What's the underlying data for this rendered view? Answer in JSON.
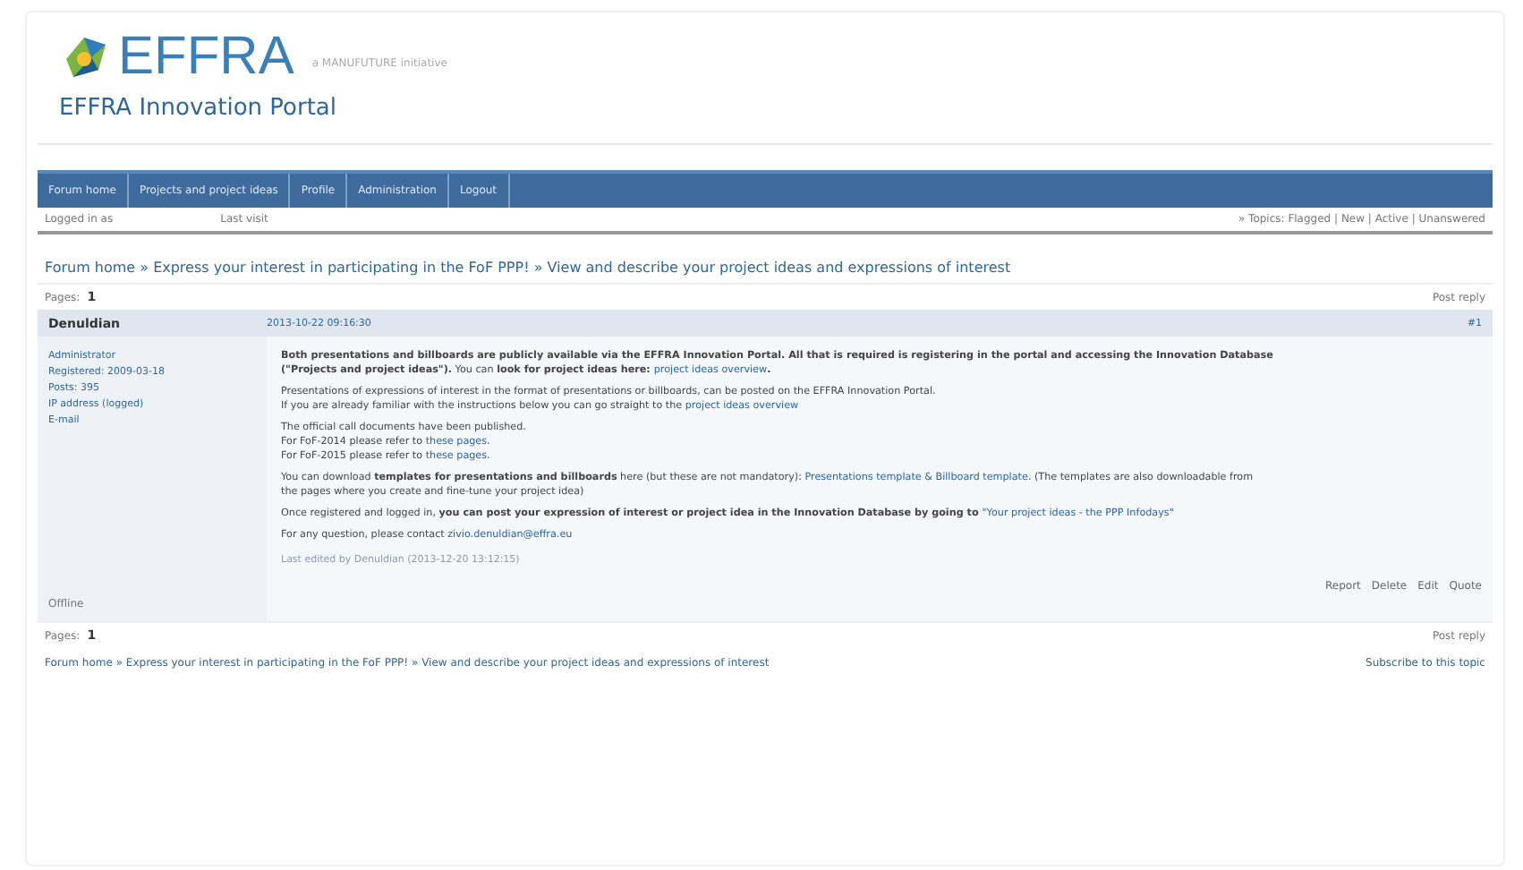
{
  "header": {
    "logo_text": "EFFRA",
    "tagline": "a MANUFUTURE initiative",
    "title": "EFFRA Innovation Portal"
  },
  "nav": [
    {
      "label": "Forum home"
    },
    {
      "label": "Projects and project ideas"
    },
    {
      "label": "Profile"
    },
    {
      "label": "Administration"
    },
    {
      "label": "Logout"
    }
  ],
  "status": {
    "logged_in": "Logged in as",
    "last_visit": "Last visit",
    "topics": "» Topics: Flagged | New | Active | Unanswered"
  },
  "breadcrumb": "Forum home » Express your interest in participating in the FoF PPP! » View and describe your project ideas and expressions of interest",
  "pages_top": {
    "label": "Pages:",
    "page": "1",
    "action": "Post reply"
  },
  "post": {
    "author": "Denuldian",
    "date": "2013-10-22 09:16:30",
    "number": "#1",
    "author_info": [
      "Administrator",
      "Registered: 2009-03-18",
      "Posts: 395",
      "IP address (logged)"
    ],
    "email": "E-mail",
    "paragraphs": [
      [
        [
          {
            "kind": "bold",
            "text": "Both presentations and billboards are publicly available via the EFFRA Innovation Portal.  All that is required is registering in the portal and accessing the Innovation Database"
          }
        ],
        [
          {
            "kind": "bold",
            "text": "(\"Projects and project ideas\")."
          },
          {
            "kind": "text",
            "text": "  You can "
          },
          {
            "kind": "bold",
            "text": "look for project ideas here: "
          },
          {
            "kind": "link",
            "text": "project ideas overview"
          },
          {
            "kind": "bold",
            "text": "."
          }
        ]
      ],
      [
        [
          {
            "kind": "text",
            "text": "Presentations of expressions of interest in the format of presentations or billboards, can be posted on the EFFRA Innovation Portal."
          }
        ],
        [
          {
            "kind": "text",
            "text": "If you are already familiar with the instructions below you can go straight to the "
          },
          {
            "kind": "link",
            "text": "project ideas overview"
          }
        ]
      ],
      [
        [
          {
            "kind": "text",
            "text": "The official call documents have been published."
          }
        ],
        [
          {
            "kind": "text",
            "text": "For FoF-2014 please refer to "
          },
          {
            "kind": "link",
            "text": "these pages"
          },
          {
            "kind": "text",
            "text": "."
          }
        ],
        [
          {
            "kind": "text",
            "text": "For FoF-2015 please refer to "
          },
          {
            "kind": "link",
            "text": "these pages"
          },
          {
            "kind": "text",
            "text": "."
          }
        ]
      ],
      [
        [
          {
            "kind": "text",
            "text": "You can download "
          },
          {
            "kind": "bold",
            "text": "templates for presentations and billboards"
          },
          {
            "kind": "text",
            "text": " here (but these are not mandatory): "
          },
          {
            "kind": "link",
            "text": "Presentations template & Billboard template"
          },
          {
            "kind": "text",
            "text": ".  (The templates are also downloadable from"
          }
        ],
        [
          {
            "kind": "text",
            "text": "the pages where you create and fine-tune your project idea)"
          }
        ]
      ],
      [
        [
          {
            "kind": "text",
            "text": "Once registered and logged in, "
          },
          {
            "kind": "bold",
            "text": "you can post your expression of interest or project idea in the Innovation Database by going to "
          },
          {
            "kind": "link",
            "text": "\"Your project ideas - the PPP Infodays\""
          }
        ]
      ],
      [
        [
          {
            "kind": "text",
            "text": "For any question, please contact "
          },
          {
            "kind": "link",
            "text": "zivio.denuldian@effra.eu"
          }
        ]
      ]
    ],
    "edited": "Last edited by Denuldian (2013-12-20 13:12:15)",
    "online_status": "Offline",
    "actions": [
      "Report",
      "Delete",
      "Edit",
      "Quote"
    ]
  },
  "pages_bottom": {
    "label": "Pages:",
    "page": "1",
    "action": "Post reply"
  },
  "footer": {
    "breadcrumb": "Forum home » Express your interest in participating in the FoF PPP! » View and describe your project ideas and expressions of interest",
    "subscribe": "Subscribe to this topic"
  }
}
